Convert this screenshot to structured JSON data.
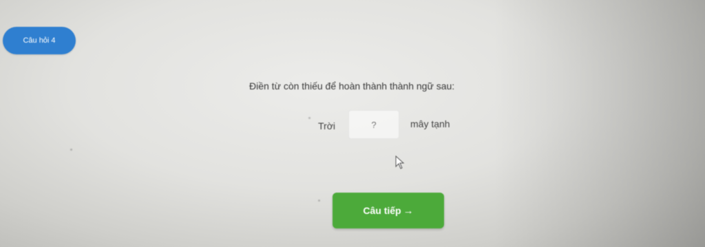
{
  "question_badge": {
    "label": "Câu hỏi 4"
  },
  "question": {
    "instruction": "Điền từ còn thiếu để hoàn thành thành ngữ sau:",
    "word_before": "Trời",
    "answer_placeholder": "?",
    "word_after": "mây tạnh"
  },
  "actions": {
    "next_label": "Câu tiếp",
    "next_arrow": "→"
  },
  "colors": {
    "badge": "#2f7fd0",
    "next_button": "#4caa3a"
  },
  "icons": {
    "cursor": "mouse-pointer-icon",
    "arrow": "arrow-right-icon"
  }
}
